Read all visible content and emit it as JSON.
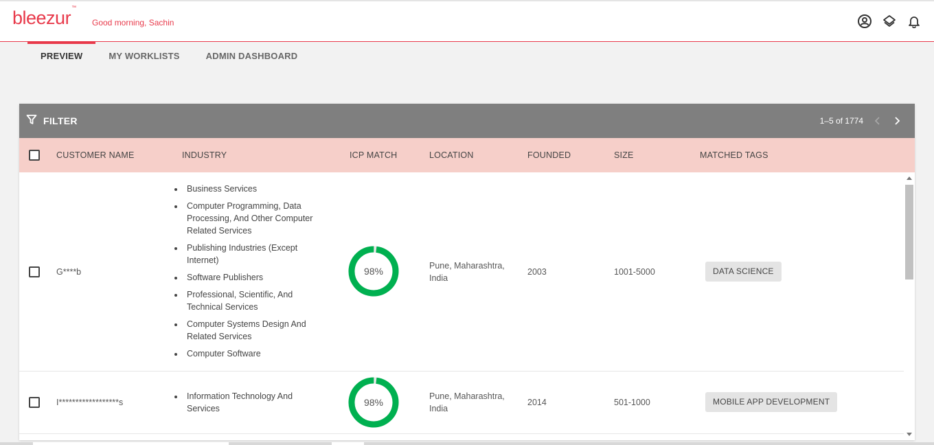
{
  "app": {
    "logo_text": "bleezur",
    "logo_tm": "™",
    "greeting": "Good morning, Sachin",
    "brand_color": "#e8394a",
    "icons": [
      "account-circle-icon",
      "layers-icon",
      "bell-icon"
    ]
  },
  "tabs": [
    {
      "label": "PREVIEW",
      "active": true
    },
    {
      "label": "MY WORKLISTS",
      "active": false
    },
    {
      "label": "ADMIN DASHBOARD",
      "active": false
    }
  ],
  "toolbar": {
    "filter_label": "FILTER",
    "filter_icon": "funnel-icon",
    "pagination": "1–5 of 1774",
    "prev_icon": "chevron-left-icon",
    "next_icon": "chevron-right-icon"
  },
  "table": {
    "columns": [
      "CUSTOMER NAME",
      "INDUSTRY",
      "ICP MATCH",
      "LOCATION",
      "FOUNDED",
      "SIZE",
      "MATCHED TAGS"
    ],
    "rows": [
      {
        "customer": "G****b",
        "industries": [
          "Business Services",
          "Computer Programming, Data Processing, And Other Computer Related Services",
          "Publishing Industries (Except Internet)",
          "Software Publishers",
          "Professional, Scientific, And Technical Services",
          "Computer Systems Design And Related Services",
          "Computer Software"
        ],
        "icp_match": 98,
        "icp_label": "98%",
        "location": "Pune, Maharashtra, India",
        "founded": "2003",
        "size": "1001-5000",
        "tags": [
          "DATA SCIENCE"
        ]
      },
      {
        "customer": "I******************s",
        "industries": [
          "Information Technology And Services"
        ],
        "icp_match": 98,
        "icp_label": "98%",
        "location": "Pune, Maharashtra, India",
        "founded": "2014",
        "size": "501-1000",
        "tags": [
          "MOBILE APP DEVELOPMENT"
        ]
      }
    ]
  },
  "colors": {
    "header_bg": "#f6cfc9",
    "filter_bg": "#7f7f7f",
    "donut_color": "#00b050",
    "tag_bg": "#e4e4e4"
  }
}
